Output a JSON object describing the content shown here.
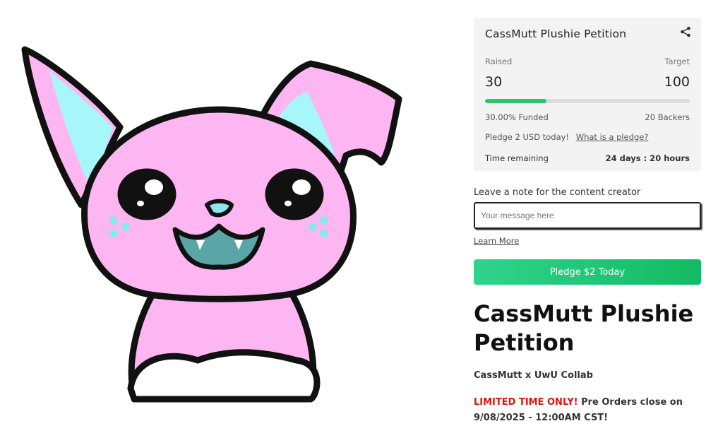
{
  "campaign": {
    "card_title": "CassMutt Plushie Petition",
    "raised_label": "Raised",
    "target_label": "Target",
    "raised_value": "30",
    "target_value": "100",
    "progress_fraction": 0.3,
    "funded_text": "30.00% Funded",
    "backers_text": "20 Backers",
    "pledge_text": "Pledge 2 USD today!",
    "pledge_link": "What is a pledge?",
    "time_label": "Time remaining",
    "time_value": "24 days : 20 hours"
  },
  "note": {
    "label": "Leave a note for the content creator",
    "placeholder": "Your message here",
    "learn_more": "Learn More"
  },
  "actions": {
    "pledge_button": "Pledge $2 Today"
  },
  "content": {
    "title": "CassMutt Plushie Petition",
    "collab": "CassMutt x UwU Collab",
    "limited_red": "LIMITED TIME ONLY!",
    "limited_rest": " Pre Orders close on 9/08/2025 - 12:00AM CST!"
  },
  "icons": {
    "share": "share-icon",
    "mascot": "pink-puppy-illustration"
  },
  "colors": {
    "accent_green": "#28c76f",
    "puppy_pink": "#fdb6f1",
    "ear_cyan": "#a6f6fa",
    "limited_red": "#e01212"
  }
}
